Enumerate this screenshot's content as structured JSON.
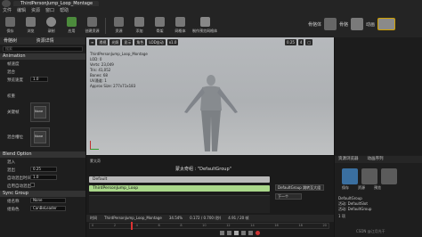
{
  "window": {
    "tab_title": "ThirdPersonJump_Loop_Montage"
  },
  "menu": [
    "文件",
    "编辑",
    "资源",
    "窗口",
    "帮助"
  ],
  "toolbar": {
    "buttons": [
      "保存",
      "浏览",
      "录制",
      "应用",
      "创建资源",
      "资源",
      "添加",
      "骨架",
      "网格体",
      "动画",
      "蓝图",
      "制作预览网格体",
      "实时"
    ],
    "mode_label": "骨骼体",
    "mode2_label": "骨骼",
    "mode3_label": "动画"
  },
  "left_panel": {
    "tabs": [
      "骨骼树",
      "资源详情"
    ],
    "search_placeholder": "搜索",
    "section_animation": "Animation",
    "rows": [
      "帧速度",
      "混合",
      "预览速度",
      "比率乘数",
      "权重",
      "关键帧",
      "Slot",
      "Montage",
      "混合槽位"
    ],
    "rate_value": "1.0",
    "none_label": "None",
    "section_blend": "Blend Option",
    "blend_rows": [
      "混入",
      "混出",
      "自动混出时间",
      "启用自动混出"
    ],
    "blend_in": "0.25",
    "blend_out": "0.25",
    "blend_time": "1.0",
    "section_sync": "Sync Group",
    "sync_rows": [
      "组名称",
      "组角色"
    ],
    "sync_value": "None",
    "sync_role": "CanBeLeader"
  },
  "viewport": {
    "buttons": [
      "透视",
      "光照",
      "显示",
      "角色",
      "LOD自动",
      "x1.0"
    ],
    "stats": [
      "ThirdPersonJump_Loop_Montage",
      "LOD: 0",
      "Verts: 23,049",
      "Tris: 41,052",
      "Bones: 68",
      "UV通道: 1",
      "Approx Size: 277x71x183"
    ],
    "right_controls": [
      "0.25",
      "4"
    ]
  },
  "anim_panel": {
    "label_montage": "蒙太奇",
    "group_title": "蒙太奇组 : \"DefaultGroup\"",
    "default_track": "Default",
    "montage_track": "ThirdPersonJump_Loop",
    "group_button": "DefaultGroup 跳转至大组",
    "slot_button": "下一个",
    "timeline_label": "时间",
    "timeline_asset": "ThirdPersonJump_Loop_Montage",
    "timeline_percent": "34.54%",
    "timeline_time": "0.172 / 0.700 (秒)",
    "timeline_frames": "4.91 / 20 帧",
    "timeline_markers": [
      "0",
      "2",
      "4",
      "6",
      "8",
      "10",
      "12",
      "14",
      "16",
      "18",
      "20"
    ]
  },
  "right_panel": {
    "tabs": [
      "资源浏览器",
      "动画序列"
    ],
    "items": [
      "保存",
      "资源",
      "预览"
    ],
    "preview_items": [
      "DefaultGroup",
      "活动: DefaultSlot",
      "活动: DefaultGroup"
    ],
    "count": "1 项"
  },
  "watermark": "CSDN @江月光干"
}
